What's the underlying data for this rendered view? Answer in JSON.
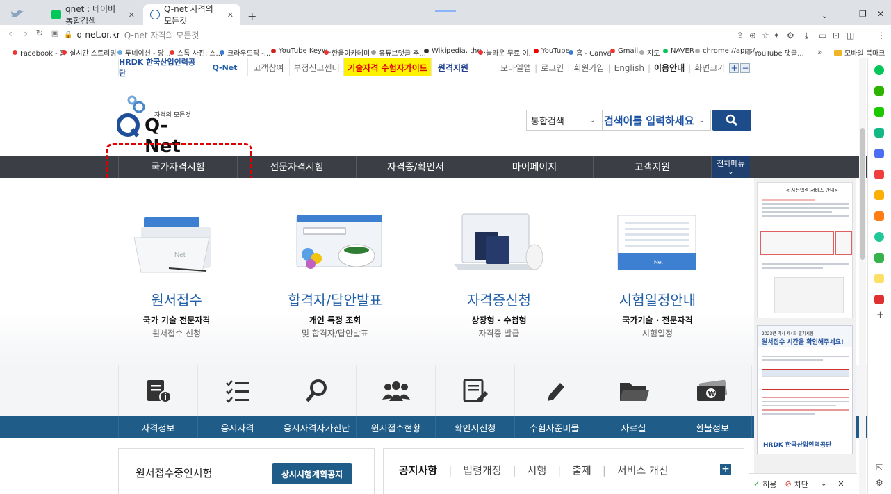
{
  "browser": {
    "tabs": [
      {
        "title": "qnet : 네이버 통합검색",
        "favicon_color": "#03c75a"
      },
      {
        "title": "Q-net 자격의 모든것",
        "favicon_color": "#1f5ea8",
        "active": true
      }
    ],
    "new_tab": "+",
    "url_host": "q-net.or.kr",
    "url_title": "Q-net 자격의 모든것",
    "bookmarks": [
      {
        "label": "Facebook - 홈",
        "color": "#e33"
      },
      {
        "label": "실시간 스트리밍",
        "color": "#e33"
      },
      {
        "label": "투네이션 - 당...",
        "color": "#6ad"
      },
      {
        "label": "스톡 사진, 스...",
        "color": "#e33"
      },
      {
        "label": "크라우드픽 -...",
        "color": "#3a7bd5"
      },
      {
        "label": "YouTube Keyw...",
        "color": "#c22"
      },
      {
        "label": "한울아카데미",
        "color": "#e33"
      },
      {
        "label": "유튜브댓글 추...",
        "color": "#999"
      },
      {
        "label": "Wikipedia, the...",
        "color": "#333"
      },
      {
        "label": "놀라운 무료 이...",
        "color": "#e33"
      },
      {
        "label": "YouTube",
        "color": "#e00"
      },
      {
        "label": "홈 - Canva",
        "color": "#3a7bd5"
      },
      {
        "label": "Gmail",
        "color": "#e33"
      },
      {
        "label": "지도",
        "color": "#aaa"
      },
      {
        "label": "NAVER",
        "color": "#03c75a"
      },
      {
        "label": "chrome://apps/",
        "color": "#aaa"
      },
      {
        "label": "YouTube 댓글...",
        "color": "#aaa"
      }
    ],
    "bookmarks_more": "»",
    "mobile_bookmarks": "모바일 북마크"
  },
  "util": {
    "hrdk": "HRDK 한국산업인력공단",
    "qnet": "Q-Net",
    "links": [
      "고객참여",
      "부정신고센터"
    ],
    "guide": "기술자격 수험자가이드",
    "remote": "원격지원",
    "right": [
      "모바일앱",
      "로그인",
      "회원가입",
      "English"
    ],
    "guide_right": "이용안내",
    "zoom": "화면크기",
    "zoom_plus": "+",
    "zoom_minus": "−"
  },
  "logo": {
    "tagline": "자격의 모든것",
    "name": "Q-Net"
  },
  "search": {
    "select": "통합검색",
    "placeholder": "검색어를 입력하세요"
  },
  "gnb": [
    "국가자격시험",
    "전문자격시험",
    "자격증/확인서",
    "마이페이지",
    "고객지원"
  ],
  "fullmenu": "전체메뉴",
  "features": [
    {
      "title": "원서접수",
      "sub1": "국가 기술 전문자격",
      "sub2": "원서접수 신청"
    },
    {
      "title": "합격자/답안발표",
      "sub1": "개인 특정 조회",
      "sub2": "및 합격자/답안발표"
    },
    {
      "title": "자격증신청",
      "sub1": "상장형 · 수첩형",
      "sub2": "자격증 발급"
    },
    {
      "title": "시험일정안내",
      "sub1": "국가기술 · 전문자격",
      "sub2": "시험일정"
    }
  ],
  "quick": [
    "자격정보",
    "응시자격",
    "응시자격자가진단",
    "원서접수현황",
    "확인서신청",
    "수험자준비물",
    "자료실",
    "환불정보"
  ],
  "exam_box": {
    "title": "원서접수중인시험",
    "button": "상시시행계획공지"
  },
  "notice_tabs": [
    "공지사항",
    "법령개정",
    "시행",
    "출제",
    "서비스 개선"
  ],
  "notice_more": "+",
  "banner1": {
    "heading": "< 사전입력 서비스 안내>"
  },
  "banner2": {
    "line1": "2023년 기사 제4회 필기시험",
    "line2": "원서접수 시간을 확인해주세요!",
    "footer": "HRDK 한국산업인력공단"
  },
  "consent": {
    "allow": "허용",
    "block": "차단"
  }
}
